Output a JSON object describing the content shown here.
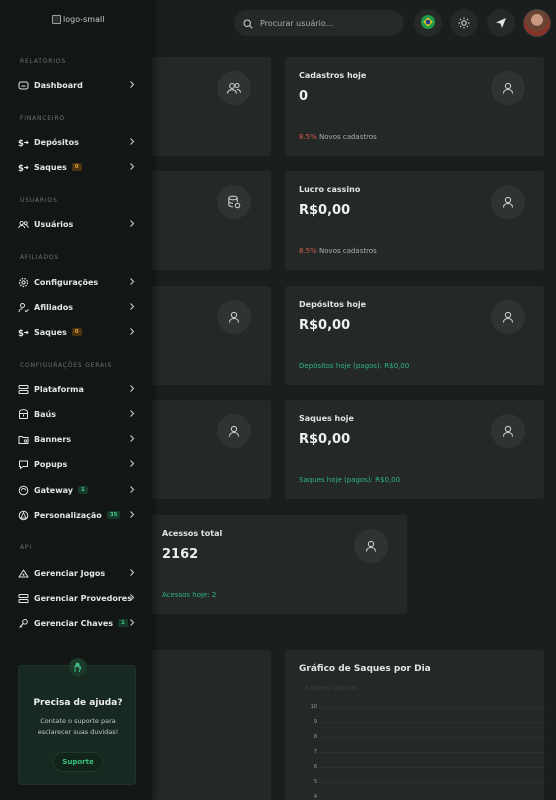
{
  "sidebar": {
    "logo_alt": "logo-small",
    "sections": {
      "relatorios": "RELATÓRIOS",
      "financeiro": "FINANCEIRO",
      "usuarios": "USUARIOS",
      "afiliados": "AFILIADOS",
      "config": "CONFIGURAÇÕES GERAIS",
      "api": "API"
    },
    "items": {
      "dashboard": "Dashboard",
      "depositos": "Depósitos",
      "saques": "Saques",
      "saques_badge": "0",
      "usuarios": "Usuários",
      "configuracoes": "Configurações",
      "afiliados": "Afiliados",
      "saques_af": "Saques",
      "saques_af_badge": "0",
      "plataforma": "Plataforma",
      "baus": "Baús",
      "banners": "Banners",
      "popups": "Popups",
      "gateway": "Gateway",
      "gateway_badge": "1",
      "personalizacao": "Personalização",
      "personalizacao_badge": "35",
      "gerenciar_jogos": "Gerenciar Jogos",
      "gerenciar_provedores": "Gerenciar Provedores",
      "gerenciar_chaves": "Gerenciar Chaves",
      "gerenciar_chaves_badge": "1"
    },
    "help": {
      "title": "Precisa de ajuda?",
      "desc": "Contate o suporte para esclarecer suas duvidas!",
      "button": "Suporte"
    }
  },
  "topbar": {
    "search_placeholder": "Procurar usuário..."
  },
  "cards": {
    "cadastros": {
      "title": "Cadastros hoje",
      "value": "0",
      "pct": "8.5%",
      "footer": "Novos cadastros"
    },
    "lucro": {
      "title": "Lucro cassino",
      "value": "R$0,00",
      "pct": "8.5%",
      "footer": "Novos cadastros"
    },
    "depositos": {
      "title": "Depósitos hoje",
      "value": "R$0,00",
      "footer": "Depósitos hoje (pagos): R$0,00"
    },
    "saques": {
      "title": "Saques hoje",
      "value": "R$0,00",
      "footer": "Saques hoje (pagos): R$0,00"
    },
    "acessos": {
      "title": "Acessos total",
      "value": "2162",
      "footer": "Acessos hoje: 2"
    }
  },
  "charts": {
    "saques": {
      "title": "Gráfico de Saques por Dia",
      "legend": "Saques Diarios",
      "yticks": [
        "10",
        "9",
        "8",
        "7",
        "6",
        "5",
        "4"
      ]
    }
  },
  "colors": {
    "accent": "#2fb58a",
    "danger": "#d65b4f",
    "badge_orange": "#e8a33a",
    "badge_green": "#41c98a"
  }
}
